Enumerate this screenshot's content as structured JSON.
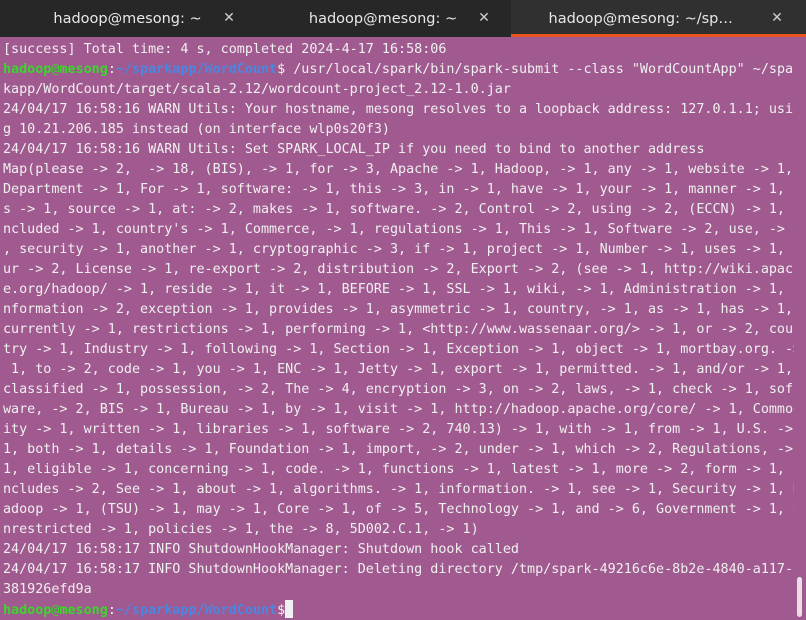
{
  "tabs": [
    {
      "title": "hadoop@mesong: ~",
      "close": "✕"
    },
    {
      "title": "hadoop@mesong: ~",
      "close": "✕"
    },
    {
      "title": "hadoop@mesong: ~/spar…",
      "close": "✕"
    }
  ],
  "prompt": {
    "user": "hadoop",
    "at": "@",
    "host": "mesong",
    "colon": ":",
    "path": "~/sparkapp/WordCount",
    "dollar": "$"
  },
  "lines_top": [
    "[success] Total time: 4 s, completed 2024-4-17 16:58:06"
  ],
  "command": {
    "first": " /usr/local/spark/bin/spark-submit --class \"WordCountApp\" ~/spar",
    "rest": "kapp/WordCount/target/scala-2.12/wordcount-project_2.12-1.0.jar"
  },
  "output": [
    "24/04/17 16:58:16 WARN Utils: Your hostname, mesong resolves to a loopback address: 127.0.1.1; usin",
    "g 10.21.206.185 instead (on interface wlp0s20f3)",
    "24/04/17 16:58:16 WARN Utils: Set SPARK_LOCAL_IP if you need to bind to another address",
    "Map(please -> 2,  -> 18, (BIS), -> 1, for -> 3, Apache -> 1, Hadoop, -> 1, any -> 1, website -> 1,",
    "Department -> 1, For -> 1, software: -> 1, this -> 3, in -> 1, have -> 1, your -> 1, manner -> 1, i",
    "s -> 1, source -> 1, at: -> 2, makes -> 1, software. -> 2, Control -> 2, using -> 2, (ECCN) -> 1, i",
    "ncluded -> 1, country's -> 1, Commerce, -> 1, regulations -> 1, This -> 1, Software -> 2, use, -> 2",
    ", security -> 1, another -> 1, cryptographic -> 3, if -> 1, project -> 1, Number -> 1, uses -> 1, o",
    "ur -> 2, License -> 1, re-export -> 2, distribution -> 2, Export -> 2, (see -> 1, http://wiki.apache",
    "e.org/hadoop/ -> 1, reside -> 1, it -> 1, BEFORE -> 1, SSL -> 1, wiki, -> 1, Administration -> 1, i",
    "nformation -> 2, exception -> 1, provides -> 1, asymmetric -> 1, country, -> 1, as -> 1, has -> 1,",
    "currently -> 1, restrictions -> 1, performing -> 1, <http://www.wassenaar.org/> -> 1, or -> 2, coun",
    "try -> 1, Industry -> 1, following -> 1, Section -> 1, Exception -> 1, object -> 1, mortbay.org. ->",
    " 1, to -> 2, code -> 1, you -> 1, ENC -> 1, Jetty -> 1, export -> 1, permitted. -> 1, and/or -> 1,",
    "classified -> 1, possession, -> 2, The -> 4, encryption -> 3, on -> 2, laws, -> 1, check -> 1, soft",
    "ware, -> 2, BIS -> 1, Bureau -> 1, by -> 1, visit -> 1, http://hadoop.apache.org/core/ -> 1, Commod",
    "ity -> 1, written -> 1, libraries -> 1, software -> 2, 740.13) -> 1, with -> 1, from -> 1, U.S. ->",
    "1, both -> 1, details -> 1, Foundation -> 1, import, -> 2, under -> 1, which -> 2, Regulations, ->",
    "1, eligible -> 1, concerning -> 1, code. -> 1, functions -> 1, latest -> 1, more -> 2, form -> 1, i",
    "ncludes -> 2, See -> 1, about -> 1, algorithms. -> 1, information. -> 1, see -> 1, Security -> 1, H",
    "adoop -> 1, (TSU) -> 1, may -> 1, Core -> 1, of -> 5, Technology -> 1, and -> 6, Government -> 1, U",
    "nrestricted -> 1, policies -> 1, the -> 8, 5D002.C.1, -> 1)",
    "24/04/17 16:58:17 INFO ShutdownHookManager: Shutdown hook called",
    "24/04/17 16:58:17 INFO ShutdownHookManager: Deleting directory /tmp/spark-49216c6e-8b2e-4840-a117-c",
    "381926efd9a"
  ]
}
